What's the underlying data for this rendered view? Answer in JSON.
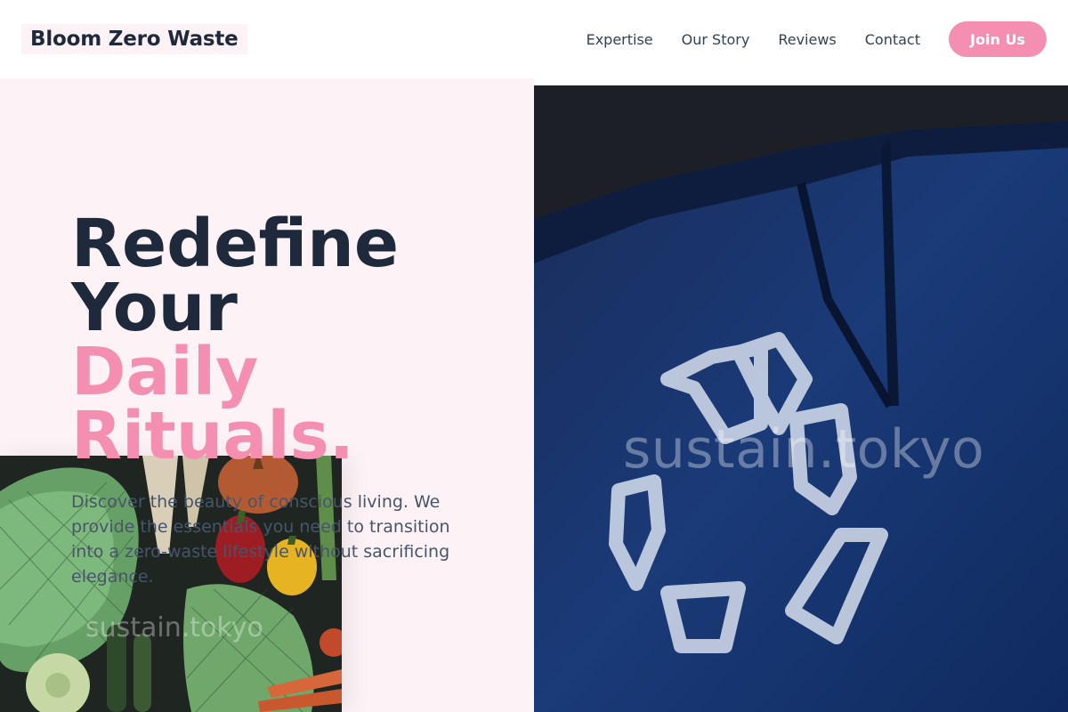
{
  "header": {
    "logo": "Bloom Zero Waste",
    "nav": [
      {
        "label": "Expertise"
      },
      {
        "label": "Our Story"
      },
      {
        "label": "Reviews"
      },
      {
        "label": "Contact"
      }
    ],
    "cta_label": "Join Us"
  },
  "hero": {
    "title_line1": "Redefine",
    "title_line2": "Your",
    "title_accent_line1": "Daily",
    "title_accent_line2": "Rituals.",
    "description": "Discover the beauty of conscious living. We provide the essentials you need to transition into a zero-waste lifestyle without sacrificing elegance."
  },
  "images": {
    "veggie_watermark": "sustain.tokyo",
    "recycle_watermark": "sustain.tokyo"
  },
  "colors": {
    "accent": "#f48fb1",
    "hero_bg": "#fdf2f6",
    "text_dark": "#1e293b"
  }
}
